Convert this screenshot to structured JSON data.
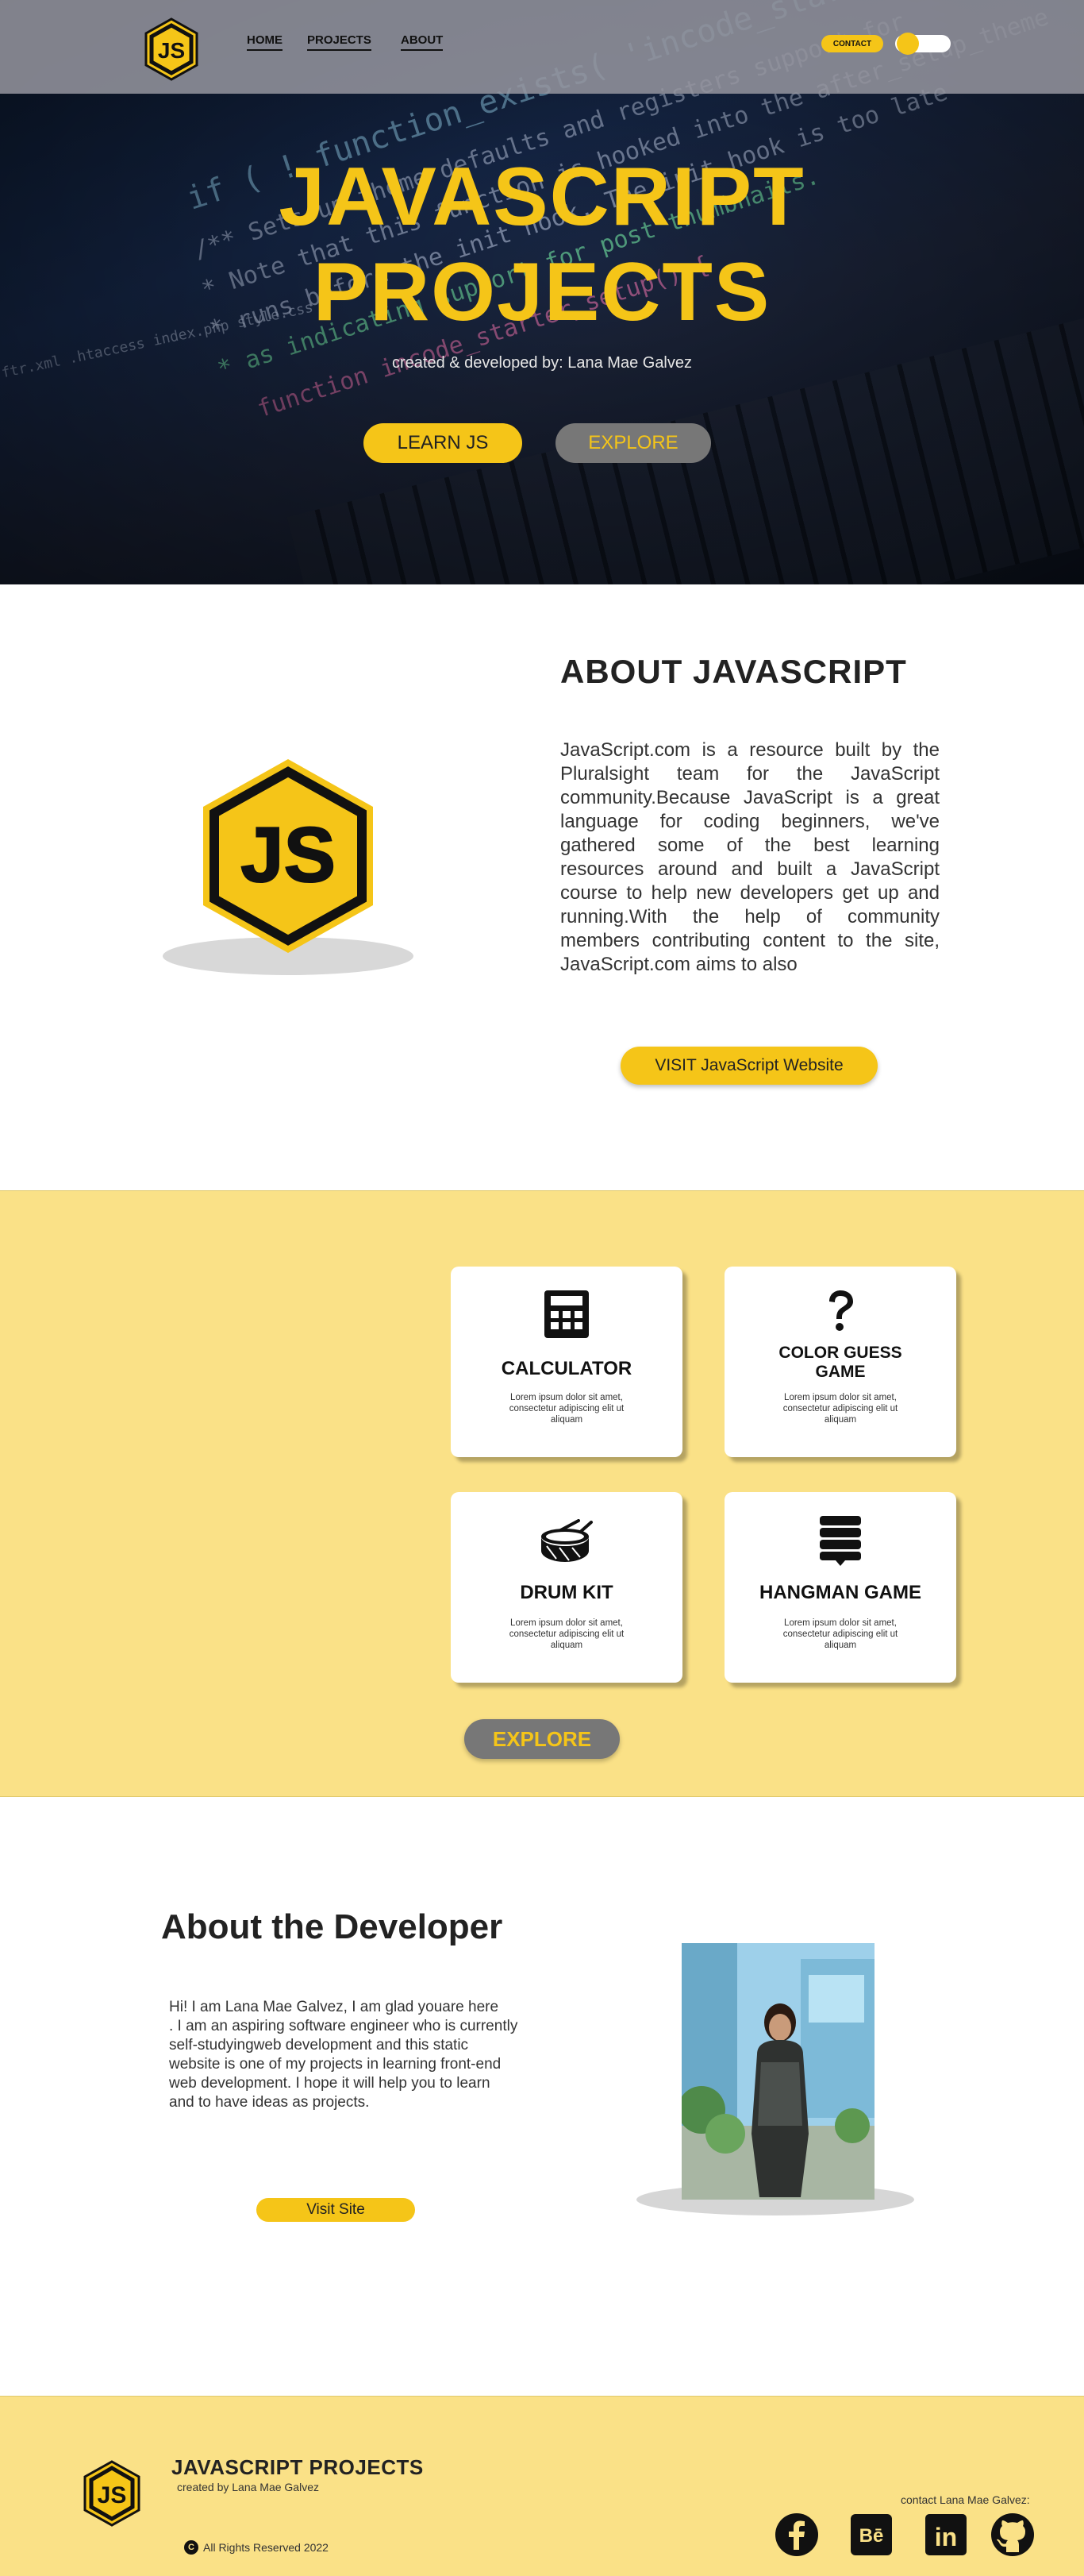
{
  "nav": {
    "links": [
      "HOME",
      "PROJECTS",
      "ABOUT"
    ],
    "contact_label": "CONTACT",
    "logo_text": "JS"
  },
  "hero": {
    "title_line1": "JAVASCRIPT",
    "title_line2": "PROJECTS",
    "subtitle": "created & developed by: Lana Mae Galvez",
    "learn_label": "LEARN JS",
    "explore_label": "EXPLORE"
  },
  "about_js": {
    "title": "ABOUT JAVASCRIPT",
    "text": "JavaScript.com is a resource built by the Pluralsight team for the JavaScript community.Because JavaScript is a great language for coding beginners, we've gathered some of the best learning resources around and built a JavaScript course to help new developers get up and running.With the help of community members contributing content to the site, JavaScript.com aims to also",
    "visit_label": "VISIT JavaScript Website",
    "logo_text": "JS"
  },
  "projects": {
    "cards": [
      {
        "title": "CALCULATOR",
        "desc": "Lorem ipsum dolor sit amet, consectetur adipiscing elit ut aliquam",
        "icon": "calculator-icon"
      },
      {
        "title": "COLOR GUESS GAME",
        "desc": "Lorem ipsum dolor sit amet, consectetur adipiscing elit ut aliquam",
        "icon": "question-icon"
      },
      {
        "title": "DRUM KIT",
        "desc": "Lorem ipsum dolor sit amet, consectetur adipiscing elit ut aliquam",
        "icon": "drum-icon"
      },
      {
        "title": "HANGMAN GAME",
        "desc": "Lorem ipsum dolor sit amet, consectetur adipiscing elit ut aliquam",
        "icon": "hangman-icon"
      }
    ],
    "explore_label": "EXPLORE"
  },
  "developer": {
    "title": "About the Developer",
    "text": "Hi! I am Lana Mae Galvez, I am glad youare here\n. I am an aspiring software engineer who is currently\n self-studyingweb development and this static\nwebsite is one of my projects in learning front-end\n web development. I hope it will help you to learn\nand to have ideas as projects.",
    "visit_label": "Visit Site"
  },
  "footer": {
    "title": "JAVASCRIPT PROJECTS",
    "subtitle": "created by Lana Mae Galvez",
    "rights": "All Rights Reserved 2022",
    "copyright_symbol": "C",
    "contact": "contact Lana Mae Galvez:",
    "social": [
      "facebook-icon",
      "behance-icon",
      "linkedin-icon",
      "github-icon"
    ],
    "behance_text": "Bē",
    "linkedin_text": "in"
  },
  "colors": {
    "accent": "#f5c518",
    "section_bg": "#fae187",
    "button_gray": "#777777",
    "hero_bg": "#0d1b33"
  }
}
